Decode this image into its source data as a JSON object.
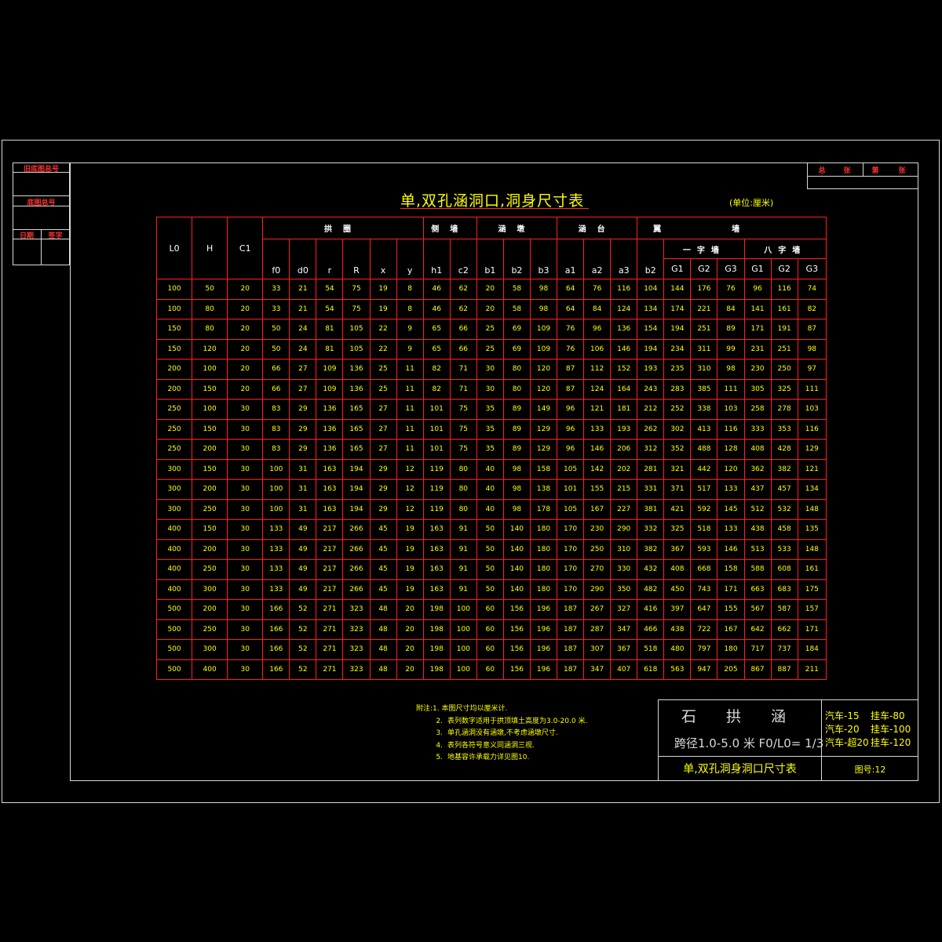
{
  "left_stamp": {
    "row1": "旧底图总号",
    "row2": "底图总号",
    "row3_a": "日期",
    "row3_b": "签字"
  },
  "top_right_stamp": {
    "a": "总",
    "b": "张",
    "c": "第",
    "d": "张"
  },
  "title": "单,双孔涵洞口,洞身尺寸表",
  "unit": "(单位:厘米)",
  "table": {
    "group_headers": {
      "arch": "拱圈",
      "side_wall": "侧墙",
      "culvert_abutment": "涵墩",
      "culvert_platform": "涵台",
      "wing_wall": "翼墙",
      "straight_wall": "一字墙",
      "splay_wall": "八字墙"
    },
    "columns": [
      "L0",
      "H",
      "C1",
      "f0",
      "d0",
      "r",
      "R",
      "x",
      "y",
      "h1",
      "c2",
      "b1",
      "b2",
      "b3",
      "a1",
      "a2",
      "a3",
      "b2",
      "G1",
      "G2",
      "G3",
      "G1",
      "G2",
      "G3"
    ],
    "rows": [
      [
        "100",
        "50",
        "20",
        "33",
        "21",
        "54",
        "75",
        "19",
        "8",
        "46",
        "62",
        "20",
        "58",
        "98",
        "64",
        "76",
        "116",
        "104",
        "144",
        "176",
        "76",
        "96",
        "116",
        "74"
      ],
      [
        "100",
        "80",
        "20",
        "33",
        "21",
        "54",
        "75",
        "19",
        "8",
        "46",
        "62",
        "20",
        "58",
        "98",
        "64",
        "84",
        "124",
        "134",
        "174",
        "221",
        "84",
        "141",
        "161",
        "82"
      ],
      [
        "150",
        "80",
        "20",
        "50",
        "24",
        "81",
        "105",
        "22",
        "9",
        "65",
        "66",
        "25",
        "69",
        "109",
        "76",
        "96",
        "136",
        "154",
        "194",
        "251",
        "89",
        "171",
        "191",
        "87"
      ],
      [
        "150",
        "120",
        "20",
        "50",
        "24",
        "81",
        "105",
        "22",
        "9",
        "65",
        "66",
        "25",
        "69",
        "109",
        "76",
        "106",
        "146",
        "194",
        "234",
        "311",
        "99",
        "231",
        "251",
        "98"
      ],
      [
        "200",
        "100",
        "20",
        "66",
        "27",
        "109",
        "136",
        "25",
        "11",
        "82",
        "71",
        "30",
        "80",
        "120",
        "87",
        "112",
        "152",
        "193",
        "235",
        "310",
        "98",
        "230",
        "250",
        "97"
      ],
      [
        "200",
        "150",
        "20",
        "66",
        "27",
        "109",
        "136",
        "25",
        "11",
        "82",
        "71",
        "30",
        "80",
        "120",
        "87",
        "124",
        "164",
        "243",
        "283",
        "385",
        "111",
        "305",
        "325",
        "111"
      ],
      [
        "250",
        "100",
        "30",
        "83",
        "29",
        "136",
        "165",
        "27",
        "11",
        "101",
        "75",
        "35",
        "89",
        "149",
        "96",
        "121",
        "181",
        "212",
        "252",
        "338",
        "103",
        "258",
        "278",
        "103"
      ],
      [
        "250",
        "150",
        "30",
        "83",
        "29",
        "136",
        "165",
        "27",
        "11",
        "101",
        "75",
        "35",
        "89",
        "129",
        "96",
        "133",
        "193",
        "262",
        "302",
        "413",
        "116",
        "333",
        "353",
        "116"
      ],
      [
        "250",
        "200",
        "30",
        "83",
        "29",
        "136",
        "165",
        "27",
        "11",
        "101",
        "75",
        "35",
        "89",
        "129",
        "96",
        "146",
        "206",
        "312",
        "352",
        "488",
        "128",
        "408",
        "428",
        "129"
      ],
      [
        "300",
        "150",
        "30",
        "100",
        "31",
        "163",
        "194",
        "29",
        "12",
        "119",
        "80",
        "40",
        "98",
        "158",
        "105",
        "142",
        "202",
        "281",
        "321",
        "442",
        "120",
        "362",
        "382",
        "121"
      ],
      [
        "300",
        "200",
        "30",
        "100",
        "31",
        "163",
        "194",
        "29",
        "12",
        "119",
        "80",
        "40",
        "98",
        "138",
        "101",
        "155",
        "215",
        "331",
        "371",
        "517",
        "133",
        "437",
        "457",
        "134"
      ],
      [
        "300",
        "250",
        "30",
        "100",
        "31",
        "163",
        "194",
        "29",
        "12",
        "119",
        "80",
        "40",
        "98",
        "178",
        "105",
        "167",
        "227",
        "381",
        "421",
        "592",
        "145",
        "512",
        "532",
        "148"
      ],
      [
        "400",
        "150",
        "30",
        "133",
        "49",
        "217",
        "266",
        "45",
        "19",
        "163",
        "91",
        "50",
        "140",
        "180",
        "170",
        "230",
        "290",
        "332",
        "325",
        "518",
        "133",
        "438",
        "458",
        "135"
      ],
      [
        "400",
        "200",
        "30",
        "133",
        "49",
        "217",
        "266",
        "45",
        "19",
        "163",
        "91",
        "50",
        "140",
        "180",
        "170",
        "250",
        "310",
        "382",
        "367",
        "593",
        "146",
        "513",
        "533",
        "148"
      ],
      [
        "400",
        "250",
        "30",
        "133",
        "49",
        "217",
        "266",
        "45",
        "19",
        "163",
        "91",
        "50",
        "140",
        "180",
        "170",
        "270",
        "330",
        "432",
        "408",
        "668",
        "158",
        "588",
        "608",
        "161"
      ],
      [
        "400",
        "300",
        "30",
        "133",
        "49",
        "217",
        "266",
        "45",
        "19",
        "163",
        "91",
        "50",
        "140",
        "180",
        "170",
        "290",
        "350",
        "482",
        "450",
        "743",
        "171",
        "663",
        "683",
        "175"
      ],
      [
        "500",
        "200",
        "30",
        "166",
        "52",
        "271",
        "323",
        "48",
        "20",
        "198",
        "100",
        "60",
        "156",
        "196",
        "187",
        "267",
        "327",
        "416",
        "397",
        "647",
        "155",
        "567",
        "587",
        "157"
      ],
      [
        "500",
        "250",
        "30",
        "166",
        "52",
        "271",
        "323",
        "48",
        "20",
        "198",
        "100",
        "60",
        "156",
        "196",
        "187",
        "287",
        "347",
        "466",
        "438",
        "722",
        "167",
        "642",
        "662",
        "171"
      ],
      [
        "500",
        "300",
        "30",
        "166",
        "52",
        "271",
        "323",
        "48",
        "20",
        "198",
        "100",
        "60",
        "156",
        "196",
        "187",
        "307",
        "367",
        "518",
        "480",
        "797",
        "180",
        "717",
        "737",
        "184"
      ],
      [
        "500",
        "400",
        "30",
        "166",
        "52",
        "271",
        "323",
        "48",
        "20",
        "198",
        "100",
        "60",
        "156",
        "196",
        "187",
        "347",
        "407",
        "618",
        "563",
        "947",
        "205",
        "867",
        "887",
        "211"
      ]
    ]
  },
  "notes": {
    "label": "附注:",
    "items": [
      {
        "num": "1.",
        "text": "本图尺寸均以厘米计."
      },
      {
        "num": "2.",
        "text": "表列数字适用于拱顶填土高度为3.0-20.0 米."
      },
      {
        "num": "3.",
        "text": "单孔涵洞没有涵墩,不考虑涵墩尺寸."
      },
      {
        "num": "4.",
        "text": "表列各符号意义同涵洞三视."
      },
      {
        "num": "5.",
        "text": "地基容许承载力详见图10."
      }
    ]
  },
  "title_block": {
    "name": "石 拱 涵",
    "spec": "跨径1.0-5.0 米 F0/L0=  1/3",
    "drawing_title": "单,双孔洞身洞口尺寸表",
    "drawing_no": "图号:12",
    "loads": [
      {
        "a": "汽车-15",
        "b": "挂车-80"
      },
      {
        "a": "汽车-20",
        "b": "挂车-100"
      },
      {
        "a": "汽车-超20",
        "b": "挂车-120"
      }
    ]
  }
}
